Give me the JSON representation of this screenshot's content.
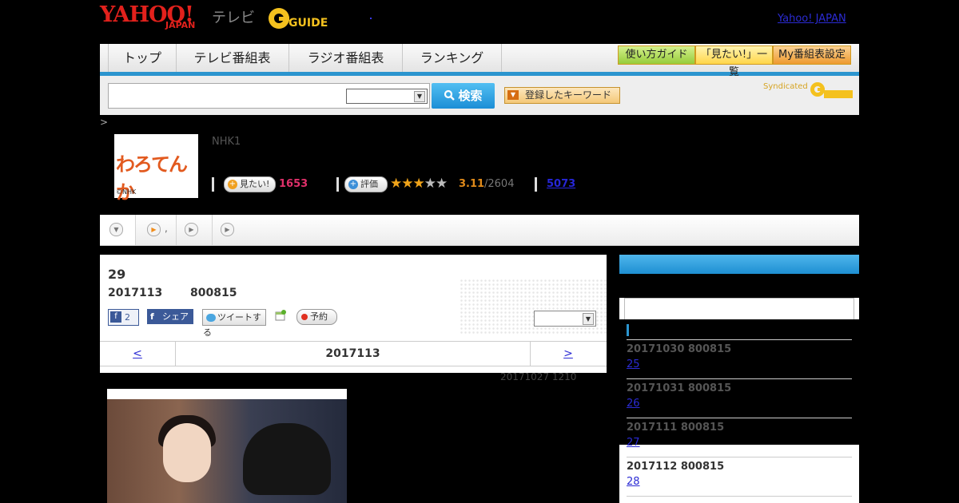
{
  "header": {
    "logo_yahoo": "YAHOO!",
    "logo_japan": "JAPAN",
    "logo_tv": "テレビ",
    "logo_gguide": "GUIDE",
    "yahoo_japan_link": "Yahoo! JAPAN"
  },
  "nav": {
    "tabs": [
      {
        "label": "トップ"
      },
      {
        "label": "テレビ番組表"
      },
      {
        "label": "ラジオ番組表"
      },
      {
        "label": "ランキング"
      }
    ],
    "guide_buttons": [
      {
        "label": "使い方ガイド",
        "color": "#a6d94a"
      },
      {
        "label": "「見たい!」一覧",
        "color": "#ffe36a"
      },
      {
        "label": "My番組表設定",
        "color": "#f2a23a"
      }
    ]
  },
  "search": {
    "input_value": "",
    "select_value": "",
    "button_label": "検索",
    "keyword_button": "登録したキーワード",
    "syndicated": "Syndicated"
  },
  "program": {
    "breadcrumb": ">",
    "thumbnail_title": "わろてんか",
    "thumbnail_credit": "©NHK",
    "channel": "NHK1",
    "mitai_label": "見たい!",
    "mitai_count": "1653",
    "rating_label": "評価",
    "rating_value": "3.11",
    "rating_count": "/2604",
    "review_count": "5073",
    "stars_filled": 3,
    "stars_total": 5
  },
  "tabbar": {
    "tab2_text": ","
  },
  "episode": {
    "number": "29",
    "air_date": "2017113",
    "air_time": "800815",
    "fb_like_count": "2",
    "fb_share_label": "シェア",
    "tweet_label": "ツイートする",
    "reserve_label": "予約",
    "select_value": "",
    "pager_prev": "<",
    "pager_current": "2017113",
    "pager_next": ">",
    "updated": "20171027  1210"
  },
  "sidebar": {
    "accent_color": "#1e8fd2",
    "items": [
      {
        "date": "20171030  800815",
        "link": "25        "
      },
      {
        "date": "20171031  800815",
        "link": "26        "
      },
      {
        "date": "2017111  800815",
        "link": "27        "
      },
      {
        "date": "2017112  800815",
        "link": "28        "
      }
    ]
  }
}
